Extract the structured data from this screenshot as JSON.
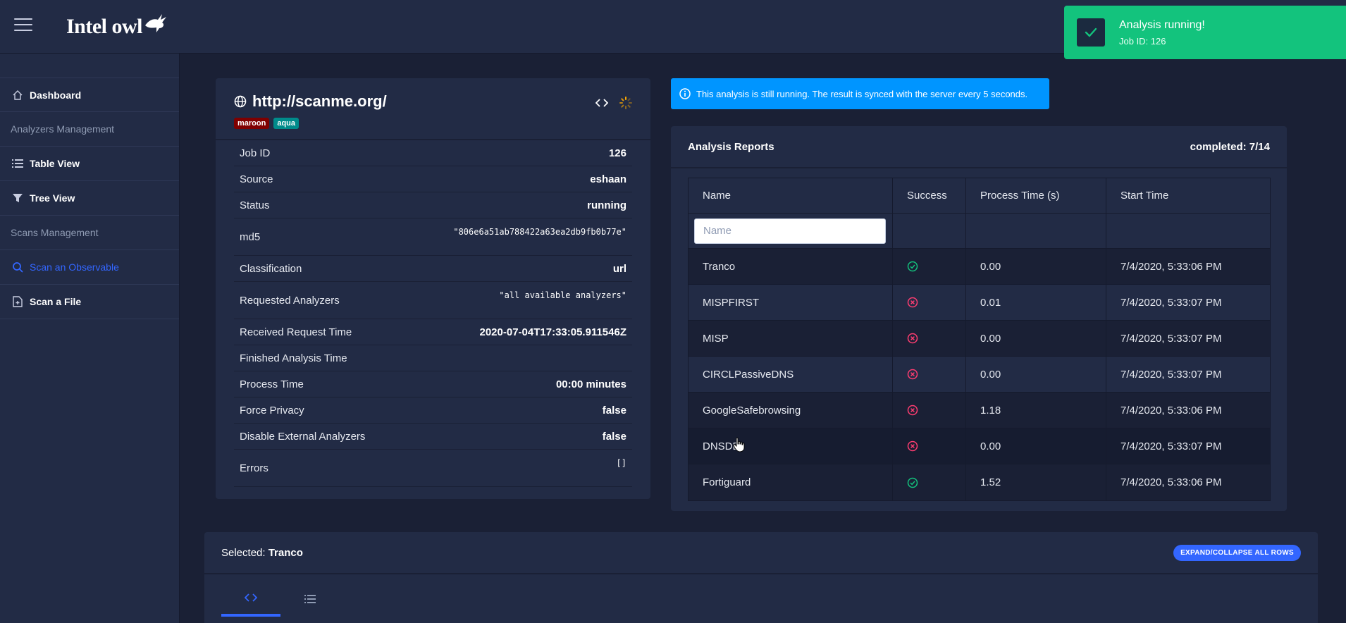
{
  "app": {
    "name": "Intel owl"
  },
  "toast": {
    "title": "Analysis running!",
    "subtitle": "Job ID: 126",
    "color": "#13c37d"
  },
  "sidebar": {
    "items": [
      {
        "label": "Dashboard",
        "icon": "home-icon"
      },
      {
        "label": "Analyzers Management",
        "type": "heading"
      },
      {
        "label": "Table View",
        "icon": "list-icon"
      },
      {
        "label": "Tree View",
        "icon": "filter-icon"
      },
      {
        "label": "Scans Management",
        "type": "heading"
      },
      {
        "label": "Scan an Observable",
        "icon": "search-icon",
        "active": true
      },
      {
        "label": "Scan a File",
        "icon": "file-icon"
      }
    ]
  },
  "job": {
    "title": "http://scanme.org/",
    "tags": [
      "maroon",
      "aqua"
    ],
    "rows": [
      {
        "label": "Job ID",
        "value": "126"
      },
      {
        "label": "Source",
        "value": "eshaan"
      },
      {
        "label": "Status",
        "value": "running"
      },
      {
        "label": "md5",
        "value": "\"806e6a51ab788422a63ea2db9fb0b77e\""
      },
      {
        "label": "Classification",
        "value": "url"
      },
      {
        "label": "Requested Analyzers",
        "value": "\"all available analyzers\""
      },
      {
        "label": "Received Request Time",
        "value": "2020-07-04T17:33:05.911546Z"
      },
      {
        "label": "Finished Analysis Time",
        "value": ""
      },
      {
        "label": "Process Time",
        "value": "00:00 minutes"
      },
      {
        "label": "Force Privacy",
        "value": "false"
      },
      {
        "label": "Disable External Analyzers",
        "value": "false"
      },
      {
        "label": "Errors",
        "value": "[]"
      }
    ]
  },
  "alert": {
    "text": "This analysis is still running. The result is synced with the server every 5 seconds."
  },
  "reports": {
    "title": "Analysis Reports",
    "completed": "completed: 7/14",
    "columns": [
      "Name",
      "Success",
      "Process Time (s)",
      "Start Time"
    ],
    "filter_placeholder": "Name",
    "rows": [
      {
        "name": "Tranco",
        "success": true,
        "time": "0.00",
        "start": "7/4/2020, 5:33:06 PM"
      },
      {
        "name": "MISPFIRST",
        "success": false,
        "time": "0.01",
        "start": "7/4/2020, 5:33:07 PM"
      },
      {
        "name": "MISP",
        "success": false,
        "time": "0.00",
        "start": "7/4/2020, 5:33:07 PM"
      },
      {
        "name": "CIRCLPassiveDNS",
        "success": false,
        "time": "0.00",
        "start": "7/4/2020, 5:33:07 PM"
      },
      {
        "name": "GoogleSafebrowsing",
        "success": false,
        "time": "1.18",
        "start": "7/4/2020, 5:33:06 PM"
      },
      {
        "name": "DNSDB",
        "success": false,
        "time": "0.00",
        "start": "7/4/2020, 5:33:07 PM"
      },
      {
        "name": "Fortiguard",
        "success": true,
        "time": "1.52",
        "start": "7/4/2020, 5:33:06 PM"
      }
    ]
  },
  "selected": {
    "prefix": "Selected:",
    "name": "Tranco",
    "expand_label": "EXPAND/COLLAPSE ALL ROWS"
  },
  "colors": {
    "success": "#13c37d",
    "error": "#ff3d71",
    "accent": "#3366ff",
    "info": "#0095ff"
  }
}
